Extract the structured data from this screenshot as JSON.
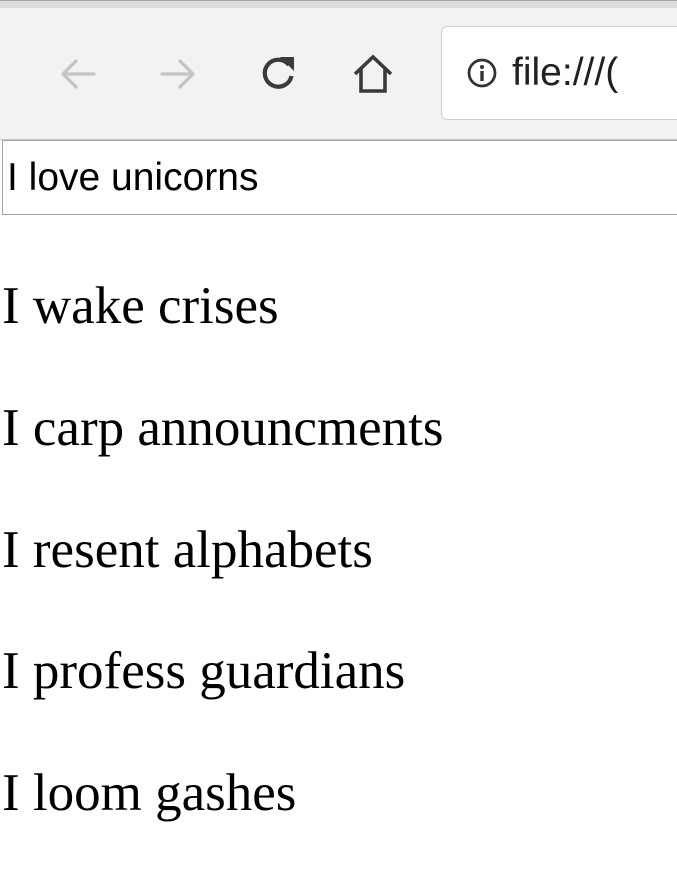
{
  "browser": {
    "toolbar": {
      "back_icon": "back-arrow-icon",
      "forward_icon": "forward-arrow-icon",
      "reload_icon": "reload-icon",
      "home_icon": "home-icon",
      "disabled_color": "#c4c4c4",
      "enabled_color": "#3a3a3a"
    },
    "address_bar": {
      "info_icon": "info-icon",
      "url": "file:///("
    }
  },
  "page": {
    "input_value": "I love unicorns",
    "lines": [
      "I wake crises",
      "I carp announcments",
      "I resent alphabets",
      "I profess guardians",
      "I loom gashes"
    ]
  }
}
